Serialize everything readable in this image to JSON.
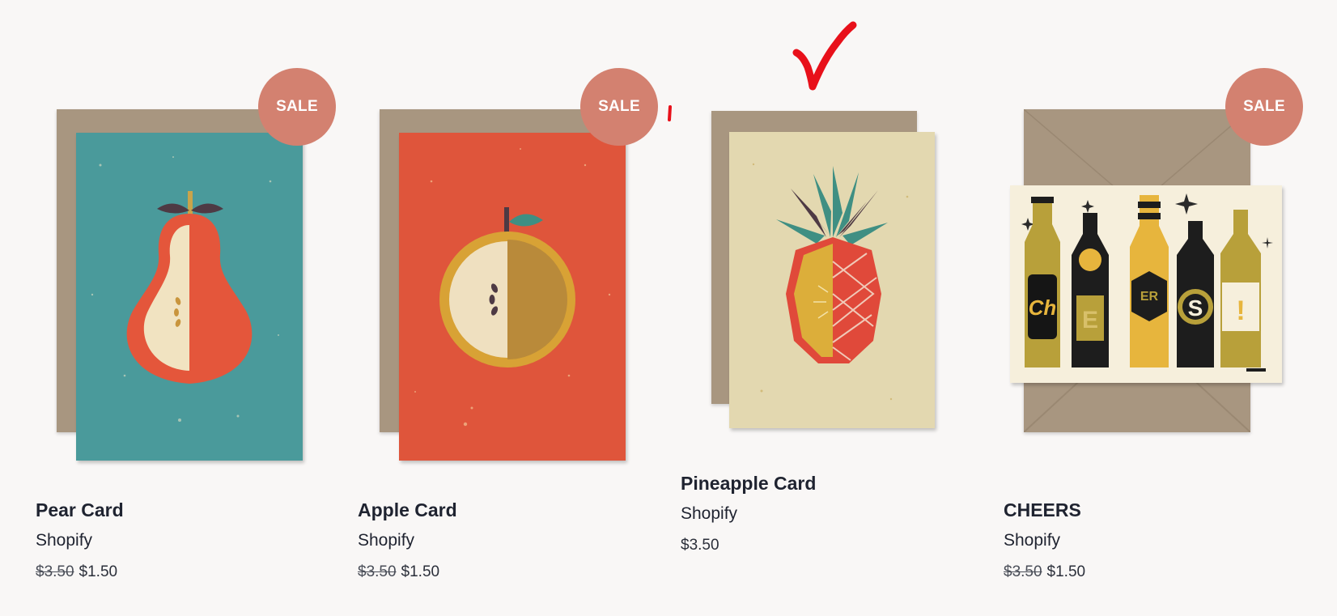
{
  "products": [
    {
      "title": "Pear Card",
      "vendor": "Shopify",
      "compare_price": "$3.50",
      "price": "$1.50",
      "badge": "SALE"
    },
    {
      "title": "Apple Card",
      "vendor": "Shopify",
      "compare_price": "$3.50",
      "price": "$1.50",
      "badge": "SALE"
    },
    {
      "title": "Pineapple Card",
      "vendor": "Shopify",
      "compare_price": "",
      "price": "$3.50",
      "badge": ""
    },
    {
      "title": "CHEERS",
      "vendor": "Shopify",
      "compare_price": "$3.50",
      "price": "$1.50",
      "badge": "SALE"
    }
  ],
  "cheers_lettering": [
    "Ch",
    "E",
    "ER",
    "S",
    "!"
  ],
  "colors": {
    "background": "#f9f7f6",
    "sale_badge": "#d38170",
    "envelope": "#a89680",
    "pear_card": "#4a9a9b",
    "apple_card": "#df553b",
    "pineapple_card": "#e3d8b0",
    "cheers_card": "#f6efdc",
    "checkmark": "#e8101a"
  },
  "icons": {
    "annotation": "red-checkmark-icon"
  }
}
